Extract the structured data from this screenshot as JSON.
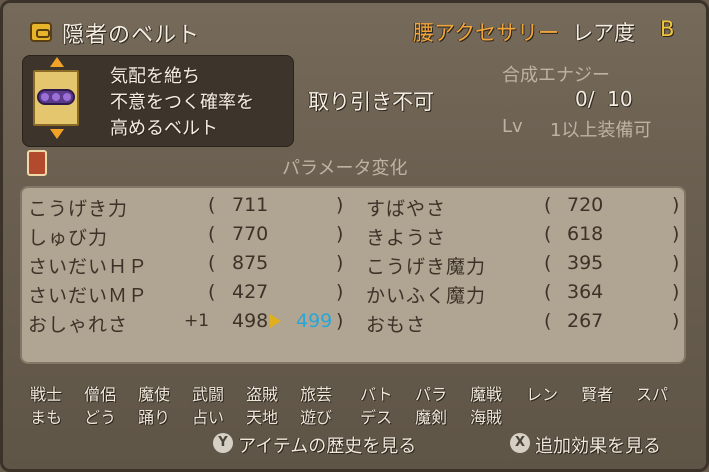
{
  "header": {
    "item_name": "隠者のベルト",
    "category": "腰アクセサリー",
    "rarity_label": "レア度",
    "rarity_value": "B"
  },
  "description": [
    "気配を絶ち",
    "不意をつく確率を",
    "高めるベルト"
  ],
  "trade_status": "取り引き不可",
  "synthesis": {
    "label": "合成エナジー",
    "value": "0/  10",
    "level_label": "Lv",
    "level_value": "1以上装備可"
  },
  "params_title": "パラメータ変化",
  "stats_left": [
    {
      "name": "こうげき力",
      "value": "711"
    },
    {
      "name": "しゅび力",
      "value": "770"
    },
    {
      "name": "さいだいＨＰ",
      "value": "875"
    },
    {
      "name": "さいだいＭＰ",
      "value": "427"
    },
    {
      "name": "おしゃれさ",
      "bonus": "+1",
      "value": "498",
      "new_value": "499"
    }
  ],
  "stats_right": [
    {
      "name": "すばやさ",
      "value": "720"
    },
    {
      "name": "きようさ",
      "value": "618"
    },
    {
      "name": "こうげき魔力",
      "value": "395"
    },
    {
      "name": "かいふく魔力",
      "value": "364"
    },
    {
      "name": "おもさ",
      "value": "267"
    }
  ],
  "jobs_row1": [
    "戦士",
    "僧侶",
    "魔使",
    "武闘",
    "盗賊",
    "旅芸",
    "バト",
    "パラ",
    "魔戦",
    "レン",
    "賢者",
    "スパ"
  ],
  "jobs_row2": [
    "まも",
    "どう",
    "踊り",
    "占い",
    "天地",
    "遊び",
    "デス",
    "魔剣",
    "海賊"
  ],
  "footer": {
    "y_button": "Y",
    "y_label": "アイテムの歴史を見る",
    "x_button": "X",
    "x_label": "追加効果を見る"
  }
}
